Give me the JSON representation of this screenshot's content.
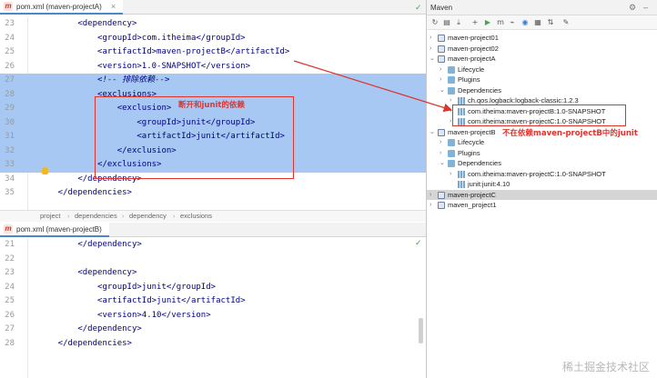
{
  "editor_a": {
    "tab_title": "pom.xml (maven-projectA)",
    "lines": [
      {
        "num": "23",
        "text": "        <dependency>"
      },
      {
        "num": "24",
        "text": "            <groupId>com.itheima</groupId>"
      },
      {
        "num": "25",
        "text": "            <artifactId>maven-projectB</artifactId>"
      },
      {
        "num": "26",
        "text": "            <version>1.0-SNAPSHOT</version>"
      },
      {
        "num": "27",
        "text": "            <!-- 排除依赖-->"
      },
      {
        "num": "28",
        "text": "            <exclusions>"
      },
      {
        "num": "29",
        "text": "                <exclusion>"
      },
      {
        "num": "30",
        "text": "                    <groupId>junit</groupId>"
      },
      {
        "num": "31",
        "text": "                    <artifactId>junit</artifactId>"
      },
      {
        "num": "32",
        "text": "                </exclusion>"
      },
      {
        "num": "33",
        "text": "            </exclusions>"
      },
      {
        "num": "34",
        "text": "        </dependency>"
      },
      {
        "num": "35",
        "text": "    </dependencies>"
      }
    ],
    "breadcrumb": [
      "project",
      "dependencies",
      "dependency",
      "exclusions"
    ],
    "annotation": "断开和junit的依赖"
  },
  "editor_b": {
    "tab_title": "pom.xml (maven-projectB)",
    "lines": [
      {
        "num": "21",
        "text": "        </dependency>"
      },
      {
        "num": "22",
        "text": ""
      },
      {
        "num": "23",
        "text": "        <dependency>"
      },
      {
        "num": "24",
        "text": "            <groupId>junit</groupId>"
      },
      {
        "num": "25",
        "text": "            <artifactId>junit</artifactId>"
      },
      {
        "num": "26",
        "text": "            <version>4.10</version>"
      },
      {
        "num": "27",
        "text": "        </dependency>"
      },
      {
        "num": "28",
        "text": "    </dependencies>"
      }
    ]
  },
  "maven": {
    "title": "Maven",
    "tree": [
      {
        "label": "maven-project01"
      },
      {
        "label": "maven-project02"
      },
      {
        "label": "maven-projectA"
      },
      {
        "label": "Lifecycle"
      },
      {
        "label": "Plugins"
      },
      {
        "label": "Dependencies"
      },
      {
        "label": "ch.qos.logback:logback-classic:1.2.3"
      },
      {
        "label": "com.itheima:maven-projectB:1.0-SNAPSHOT"
      },
      {
        "label": "com.itheima:maven-projectC:1.0-SNAPSHOT"
      },
      {
        "label": "maven-projectB"
      },
      {
        "label": "Lifecycle"
      },
      {
        "label": "Plugins"
      },
      {
        "label": "Dependencies"
      },
      {
        "label": "com.itheima:maven-projectC:1.0-SNAPSHOT"
      },
      {
        "label": "junit:junit:4.10"
      },
      {
        "label": "maven-projectC"
      },
      {
        "label": "maven_project1"
      }
    ],
    "annotation": "不在依赖maven-projectB中的junit"
  },
  "watermark": "稀土掘金技术社区",
  "colors": {
    "selection": "#a6c8f3",
    "annotation": "#e0332b",
    "tag": "#000080",
    "comment": "#8c9ea8",
    "tree_highlight": "#d5d5d5"
  },
  "icons": {
    "maven_toolbar": [
      "refresh-icon",
      "add-project-icon",
      "download-icon",
      "plus-icon",
      "run-icon",
      "maven-goal-icon",
      "toggle-offline-icon",
      "skip-tests-icon",
      "show-dependencies-icon",
      "collapse-icon",
      "settings-icon"
    ],
    "header": [
      "gear-icon",
      "minimize-icon"
    ]
  }
}
